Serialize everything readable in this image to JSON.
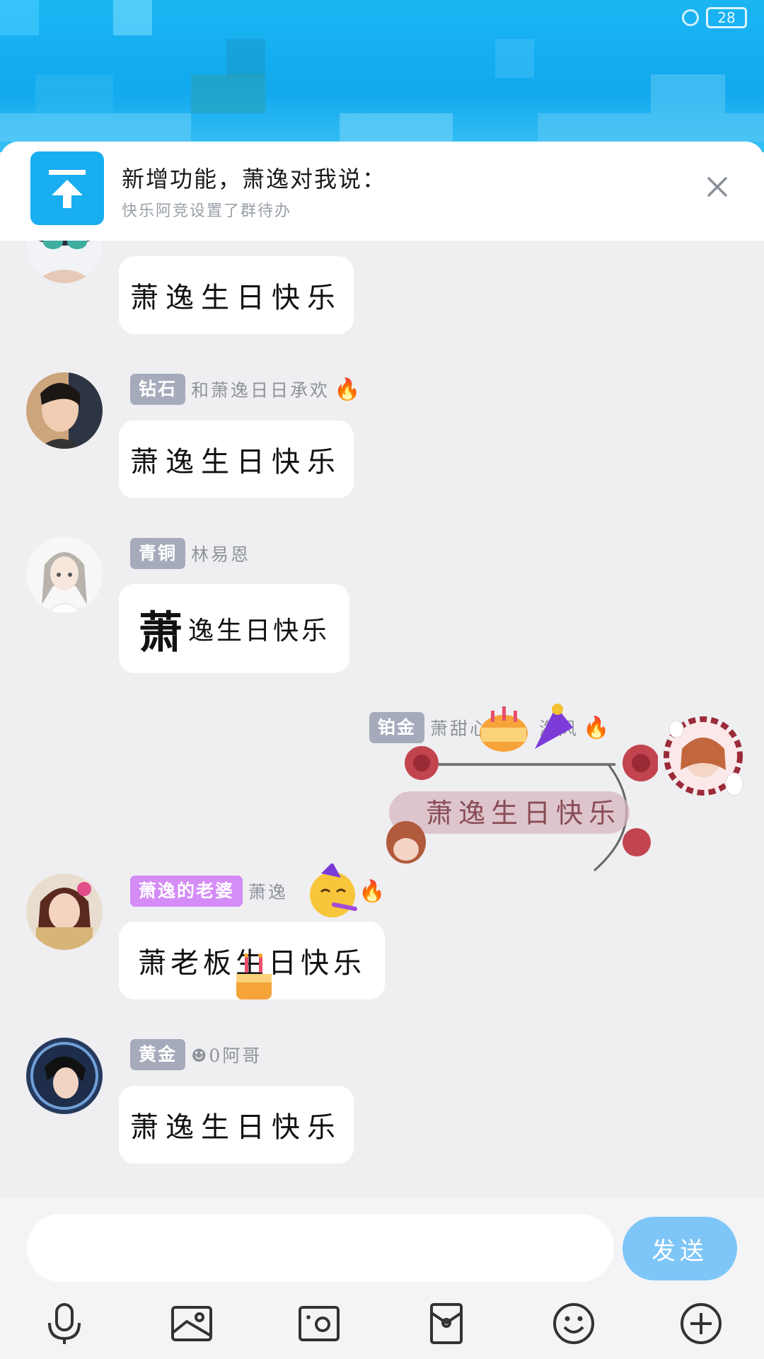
{
  "status_bar": {
    "battery": "28"
  },
  "notice": {
    "title": "新增功能，萧逸对我说：",
    "subtitle": "快乐阿竞设置了群待办"
  },
  "messages": [
    {
      "badge": "",
      "nickname": "",
      "text": "萧逸生日快乐"
    },
    {
      "badge": "钻石",
      "nickname": "和萧逸日日承欢",
      "text": "萧逸生日快乐"
    },
    {
      "badge": "青铜",
      "nickname": "林易恩",
      "text_big": "萧",
      "text_rest": "逸生日快乐"
    },
    {
      "badge": "铂金",
      "nickname": "萧甜心",
      "nickname_tail": "海风",
      "text": "萧逸生日快乐"
    },
    {
      "badge": "萧逸的老婆",
      "nickname": "萧逸",
      "text": "萧老板生日快乐"
    },
    {
      "badge": "黄金",
      "nickname": "☻0阿哥",
      "text": "萧逸生日快乐"
    }
  ],
  "input": {
    "placeholder": "",
    "send_label": "发送"
  },
  "toolbar": [
    "mic-icon",
    "image-icon",
    "camera-icon",
    "red-packet-icon",
    "emoji-icon",
    "plus-icon"
  ],
  "colors": {
    "accent": "#18aef0",
    "send": "#7fc6f8",
    "badge_gray": "#a5abbb",
    "badge_purple": "#d48cf7"
  }
}
